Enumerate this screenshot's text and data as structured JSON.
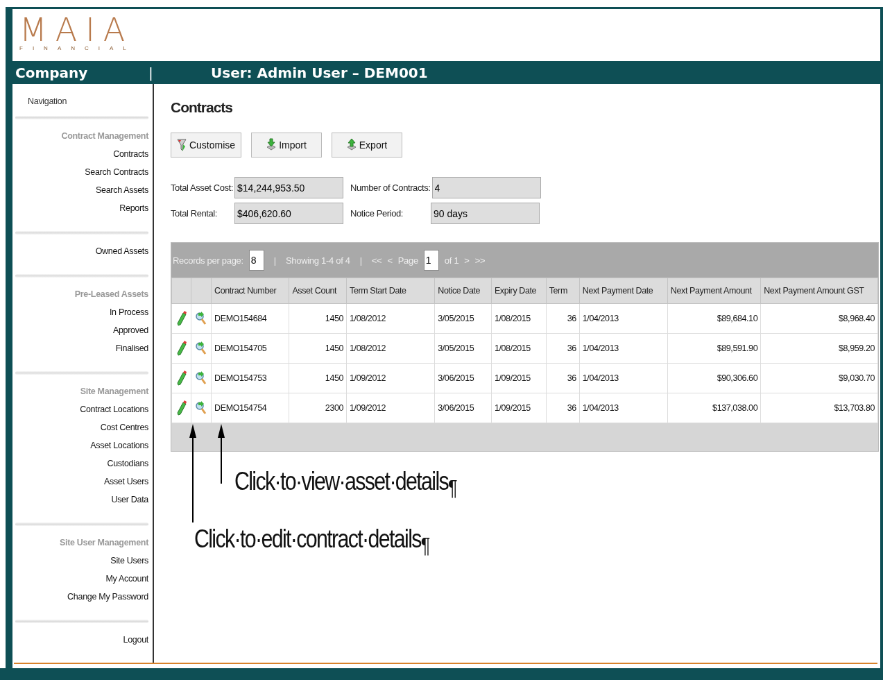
{
  "logo": {
    "name": "MAIA",
    "tagline": "FINANCIAL"
  },
  "header": {
    "company": "Company",
    "separator": "|",
    "user": "User: Admin User – DEM001"
  },
  "sidebar": {
    "title": "Navigation",
    "sections": [
      {
        "heading": "Contract Management",
        "items": [
          "Contracts",
          "Search Contracts",
          "Search Assets",
          "Reports"
        ]
      },
      {
        "items": [
          "Owned Assets"
        ]
      },
      {
        "heading": "Pre-Leased Assets",
        "items": [
          "In Process",
          "Approved",
          "Finalised"
        ]
      },
      {
        "heading": "Site Management",
        "items": [
          "Contract Locations",
          "Cost Centres",
          "Asset Locations",
          "Custodians",
          "Asset Users",
          "User Data"
        ]
      },
      {
        "heading": "Site User Management",
        "items": [
          "Site Users",
          "My Account",
          "Change My Password"
        ]
      },
      {
        "items": [
          "Logout"
        ]
      }
    ]
  },
  "page_title": "Contracts",
  "toolbar": [
    {
      "kind": "customise",
      "label": "Customise"
    },
    {
      "kind": "import",
      "label": "Import"
    },
    {
      "kind": "export",
      "label": "Export"
    }
  ],
  "summary": [
    {
      "label": "Total Asset Cost:",
      "value": "$14,244,953.50"
    },
    {
      "label": "Number of Contracts:",
      "value": "4"
    },
    {
      "label": "Total Rental:",
      "value": "$406,620.60"
    },
    {
      "label": "Notice Period:",
      "value": "90 days"
    }
  ],
  "pager": {
    "records_label": "Records per page:",
    "records_value": "8",
    "sep1": "|",
    "showing": "Showing 1-4 of 4",
    "sep2": "|",
    "first": "<<",
    "prev": "<",
    "page_label": "Page",
    "page_value": "1",
    "of": "of 1",
    "next": ">",
    "last": ">>"
  },
  "table": {
    "columns": [
      "Contract Number",
      "Asset Count",
      "Term Start Date",
      "Notice Date",
      "Expiry Date",
      "Term",
      "Next Payment Date",
      "Next Payment Amount",
      "Next Payment Amount GST"
    ],
    "rows": [
      [
        "DEMO154684",
        "1450",
        "1/08/2012",
        "3/05/2015",
        "1/08/2015",
        "36",
        "1/04/2013",
        "$89,684.10",
        "$8,968.40"
      ],
      [
        "DEMO154705",
        "1450",
        "1/08/2012",
        "3/05/2015",
        "1/08/2015",
        "36",
        "1/04/2013",
        "$89,591.90",
        "$8,959.20"
      ],
      [
        "DEMO154753",
        "1450",
        "1/09/2012",
        "3/06/2015",
        "1/09/2015",
        "36",
        "1/04/2013",
        "$90,306.60",
        "$9,030.70"
      ],
      [
        "DEMO154754",
        "2300",
        "1/09/2012",
        "3/06/2015",
        "1/09/2015",
        "36",
        "1/04/2013",
        "$137,038.00",
        "$13,703.80"
      ]
    ]
  },
  "annotations": [
    {
      "kind": "view",
      "text": "Click·to·view·asset·details$_{¶}$"
    },
    {
      "kind": "edit",
      "text": "Click·to·edit·contract·details$_{¶}$"
    }
  ]
}
